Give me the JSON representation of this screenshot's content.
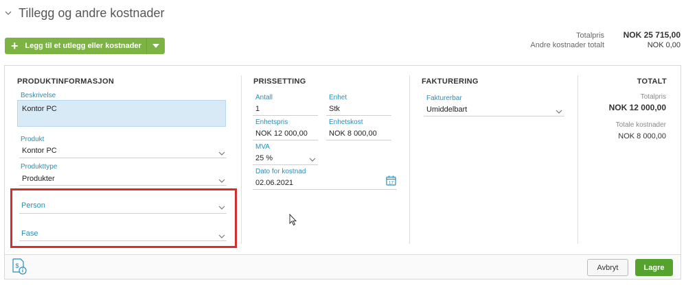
{
  "section": {
    "title": "Tillegg og andre kostnader"
  },
  "add_button": {
    "label": "Legg til et utlegg eller kostnader"
  },
  "summary": {
    "totalpris_label": "Totalpris",
    "totalpris_value": "NOK 25 715,00",
    "andre_label": "Andre kostnader totalt",
    "andre_value": "NOK 0,00"
  },
  "produktinfo": {
    "heading": "PRODUKTINFORMASJON",
    "beskrivelse_label": "Beskrivelse",
    "beskrivelse_value": "Kontor PC",
    "produkt_label": "Produkt",
    "produkt_value": "Kontor PC",
    "produkttype_label": "Produkttype",
    "produkttype_value": "Produkter",
    "person_placeholder": "Person",
    "fase_placeholder": "Fase"
  },
  "prissetting": {
    "heading": "PRISSETTING",
    "antall_label": "Antall",
    "antall_value": "1",
    "enhet_label": "Enhet",
    "enhet_value": "Stk",
    "enhetspris_label": "Enhetspris",
    "enhetspris_value": "NOK 12 000,00",
    "enhetskost_label": "Enhetskost",
    "enhetskost_value": "NOK 8 000,00",
    "mva_label": "MVA",
    "mva_value": "25 %",
    "dato_label": "Dato for kostnad",
    "dato_value": "02.06.2021"
  },
  "fakturering": {
    "heading": "FAKTURERING",
    "fakturerbar_label": "Fakturerbar",
    "fakturerbar_value": "Umiddelbart"
  },
  "totalt": {
    "heading": "TOTALT",
    "totalpris_label": "Totalpris",
    "totalpris_value": "NOK 12 000,00",
    "kostnader_label": "Totale kostnader",
    "kostnader_value": "NOK 8 000,00"
  },
  "footer": {
    "cancel_label": "Avbryt",
    "save_label": "Lagre"
  },
  "colors": {
    "accent_green": "#7cb342",
    "save_green": "#55a22f",
    "label_blue": "#2a8db5",
    "highlight_red": "#d32f2f"
  },
  "icons": [
    "chevron-down-icon",
    "plus-icon",
    "calendar-icon",
    "receipt-icon",
    "cursor-icon"
  ]
}
